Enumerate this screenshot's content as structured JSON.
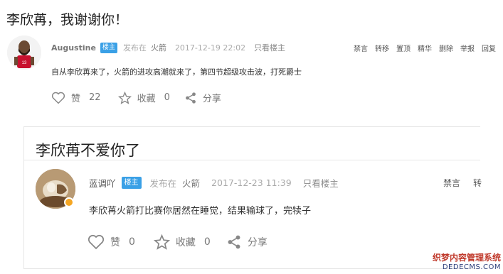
{
  "post": {
    "title": "李欣苒，我谢谢你！",
    "author": "Augustine",
    "owner_badge": "楼主",
    "posted_in_label": "发布在",
    "forum": "火箭",
    "timestamp": "2017-12-19 22:02",
    "only_owner": "只看楼主",
    "actions": [
      "禁言",
      "转移",
      "置顶",
      "精华",
      "删除",
      "举报",
      "回复"
    ],
    "content": "自从李欣苒来了，火箭的进攻高潮就来了，第四节超级攻击波，打死爵士",
    "like_label": "赞",
    "like_count": "22",
    "fav_label": "收藏",
    "fav_count": "0",
    "share_label": "分享"
  },
  "reply": {
    "title": "李欣苒不爱你了",
    "author": "蓝调吖",
    "owner_badge": "楼主",
    "posted_in_label": "发布在",
    "forum": "火箭",
    "timestamp": "2017-12-23 11:39",
    "only_owner": "只看楼主",
    "actions": [
      "禁言",
      "转"
    ],
    "content": "李欣苒火箭打比赛你居然在睡觉，结果输球了，完犊子",
    "like_label": "赞",
    "like_count": "0",
    "fav_label": "收藏",
    "fav_count": "0",
    "share_label": "分享"
  },
  "watermark": {
    "line1": "织梦内容管理系统",
    "line2": "DEDECMS.COM"
  },
  "colors": {
    "owner_badge": "#3aa0e6",
    "text": "#333333",
    "muted": "#aaaaaa"
  }
}
